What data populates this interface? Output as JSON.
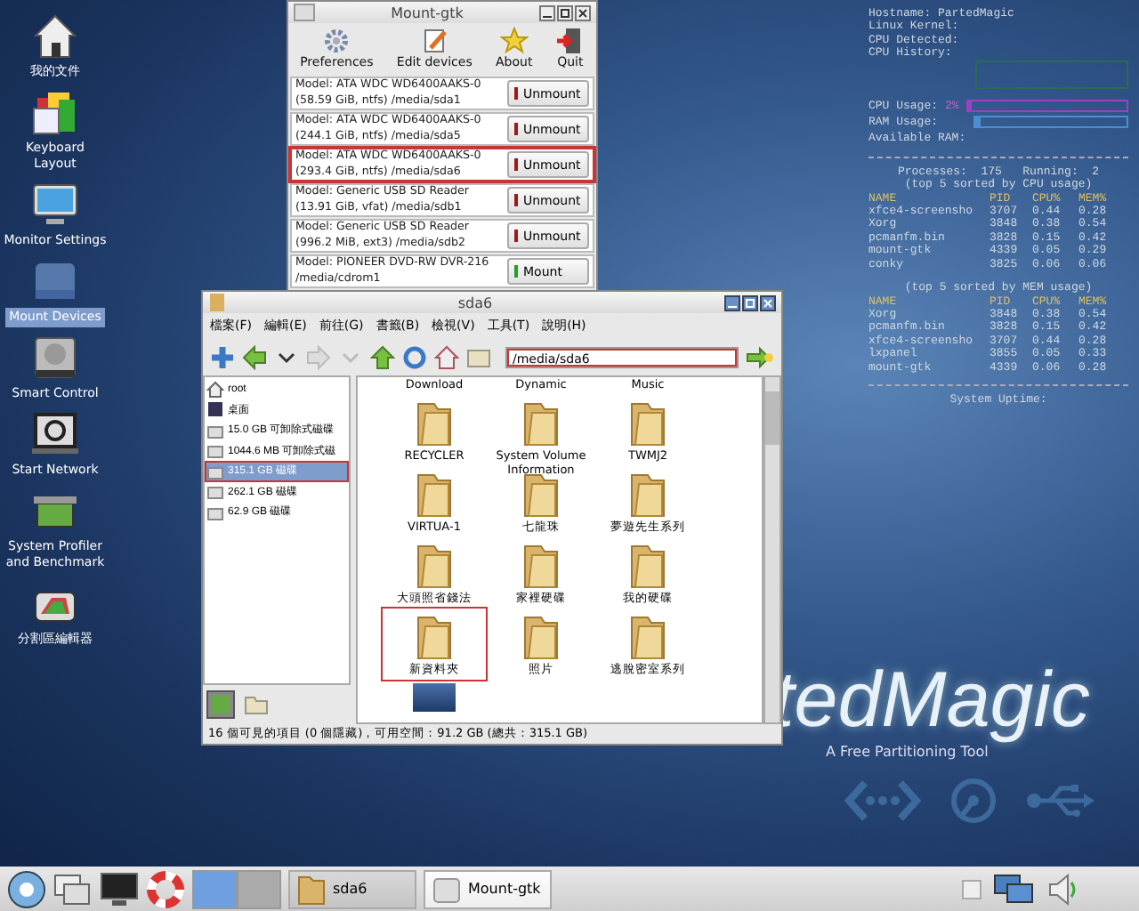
{
  "desktop_icons": [
    {
      "label": "我的文件",
      "selected": false
    },
    {
      "label": "Keyboard Layout",
      "selected": false
    },
    {
      "label": "Monitor Settings",
      "selected": false
    },
    {
      "label": "Mount Devices",
      "selected": true
    },
    {
      "label": "Smart Control",
      "selected": false
    },
    {
      "label": "Start Network",
      "selected": false
    },
    {
      "label": "System Profiler and Benchmark",
      "selected": false
    },
    {
      "label": "分割區編輯器",
      "selected": false
    }
  ],
  "mount_window": {
    "title": "Mount-gtk",
    "toolbar": [
      "Preferences",
      "Edit devices",
      "About",
      "Quit"
    ],
    "devices": [
      {
        "model": "Model: ATA WDC WD6400AAKS-0",
        "details": "(58.59 GiB, ntfs)   /media/sda1",
        "mounted": true,
        "button": "Unmount",
        "highlighted": false
      },
      {
        "model": "Model: ATA WDC WD6400AAKS-0",
        "details": "(244.1 GiB, ntfs)   /media/sda5",
        "mounted": true,
        "button": "Unmount",
        "highlighted": false
      },
      {
        "model": "Model: ATA WDC WD6400AAKS-0",
        "details": "(293.4 GiB, ntfs)   /media/sda6",
        "mounted": true,
        "button": "Unmount",
        "highlighted": true
      },
      {
        "model": "Model: Generic USB SD Reader",
        "details": "(13.91 GiB, vfat)   /media/sdb1",
        "mounted": true,
        "button": "Unmount",
        "highlighted": false
      },
      {
        "model": "Model: Generic USB SD Reader",
        "details": "(996.2 MiB, ext3)   /media/sdb2",
        "mounted": true,
        "button": "Unmount",
        "highlighted": false
      },
      {
        "model": "Model: PIONEER DVD-RW  DVR-216",
        "details": "/media/cdrom1",
        "mounted": false,
        "button": "Mount",
        "highlighted": false
      }
    ]
  },
  "file_manager": {
    "title": "sda6",
    "menu": [
      "檔案(F)",
      "編輯(E)",
      "前往(G)",
      "書籤(B)",
      "檢視(V)",
      "工具(T)",
      "說明(H)"
    ],
    "address": {
      "value": "/media/sda6",
      "highlighted": true
    },
    "places": [
      {
        "label": "root",
        "selected": false,
        "highlighted": false
      },
      {
        "label": "桌面",
        "selected": false,
        "highlighted": false
      },
      {
        "label": "15.0 GB 可卸除式磁碟",
        "selected": false,
        "highlighted": false
      },
      {
        "label": "1044.6 MB 可卸除式磁",
        "selected": false,
        "highlighted": false
      },
      {
        "label": "315.1 GB 磁碟",
        "selected": true,
        "highlighted": true
      },
      {
        "label": "262.1 GB 磁碟",
        "selected": false,
        "highlighted": false
      },
      {
        "label": "62.9 GB 磁碟",
        "selected": false,
        "highlighted": false
      }
    ],
    "files": [
      {
        "kind": "label",
        "name": "Download",
        "highlighted": false
      },
      {
        "kind": "label",
        "name": "Dynamic",
        "highlighted": false
      },
      {
        "kind": "label",
        "name": "Music",
        "highlighted": false
      },
      {
        "kind": "folder",
        "name": "RECYCLER",
        "highlighted": false
      },
      {
        "kind": "folder",
        "name": "System Volume Information",
        "highlighted": false
      },
      {
        "kind": "folder",
        "name": "TWMJ2",
        "highlighted": false
      },
      {
        "kind": "folder",
        "name": "VIRTUA-1",
        "highlighted": false
      },
      {
        "kind": "folder",
        "name": "七龍珠",
        "highlighted": false
      },
      {
        "kind": "folder",
        "name": "夢遊先生系列",
        "highlighted": false
      },
      {
        "kind": "folder",
        "name": "大頭照省錢法",
        "highlighted": false
      },
      {
        "kind": "folder",
        "name": "家裡硬碟",
        "highlighted": false
      },
      {
        "kind": "folder",
        "name": "我的硬碟",
        "highlighted": false
      },
      {
        "kind": "folder",
        "name": "新資料夾",
        "highlighted": true
      },
      {
        "kind": "folder",
        "name": "照片",
        "highlighted": false
      },
      {
        "kind": "folder",
        "name": "逃脫密室系列",
        "highlighted": false
      },
      {
        "kind": "image",
        "highlighted": false
      }
    ],
    "status": "16 個可見的項目 (0 個隱藏)，可用空間：91.2 GB (總共：315.1 GB)"
  },
  "system_monitor": {
    "info": [
      "Hostname: PartedMagic",
      "Linux Kernel:",
      "CPU Detected:",
      "CPU History:"
    ],
    "cpu": {
      "label": "CPU Usage:",
      "reading": "2%",
      "level": 0.02
    },
    "ram": {
      "label": "RAM Usage:",
      "level": 0.04
    },
    "available_ram": "Available RAM:",
    "processes": "Processes:  175   Running:  2",
    "tables": [
      {
        "caption": "(top 5 sorted by CPU usage)",
        "columns": [
          "NAME",
          "PID",
          "CPU%",
          "MEM%"
        ],
        "rows": [
          [
            "xfce4-screensho",
            "3707",
            "0.44",
            "0.28"
          ],
          [
            "Xorg",
            "3848",
            "0.38",
            "0.54"
          ],
          [
            "pcmanfm.bin",
            "3828",
            "0.15",
            "0.42"
          ],
          [
            "mount-gtk",
            "4339",
            "0.05",
            "0.29"
          ],
          [
            "conky",
            "3825",
            "0.06",
            "0.06"
          ]
        ]
      },
      {
        "caption": "(top 5 sorted by MEM usage)",
        "columns": [
          "NAME",
          "PID",
          "CPU%",
          "MEM%"
        ],
        "rows": [
          [
            "Xorg",
            "3848",
            "0.38",
            "0.54"
          ],
          [
            "pcmanfm.bin",
            "3828",
            "0.15",
            "0.42"
          ],
          [
            "xfce4-screensho",
            "3707",
            "0.44",
            "0.28"
          ],
          [
            "lxpanel",
            "3855",
            "0.05",
            "0.33"
          ],
          [
            "mount-gtk",
            "4339",
            "0.06",
            "0.28"
          ]
        ]
      }
    ],
    "uptime": "System Uptime:"
  },
  "branding": {
    "logo": "tedMagic",
    "tagline": "A Free Partitioning Tool"
  },
  "taskbar": {
    "pager": [
      {
        "selected": true
      },
      {
        "selected": false
      }
    ],
    "tasks": [
      {
        "label": "sda6",
        "active": false
      },
      {
        "label": "Mount-gtk",
        "active": true
      }
    ]
  }
}
